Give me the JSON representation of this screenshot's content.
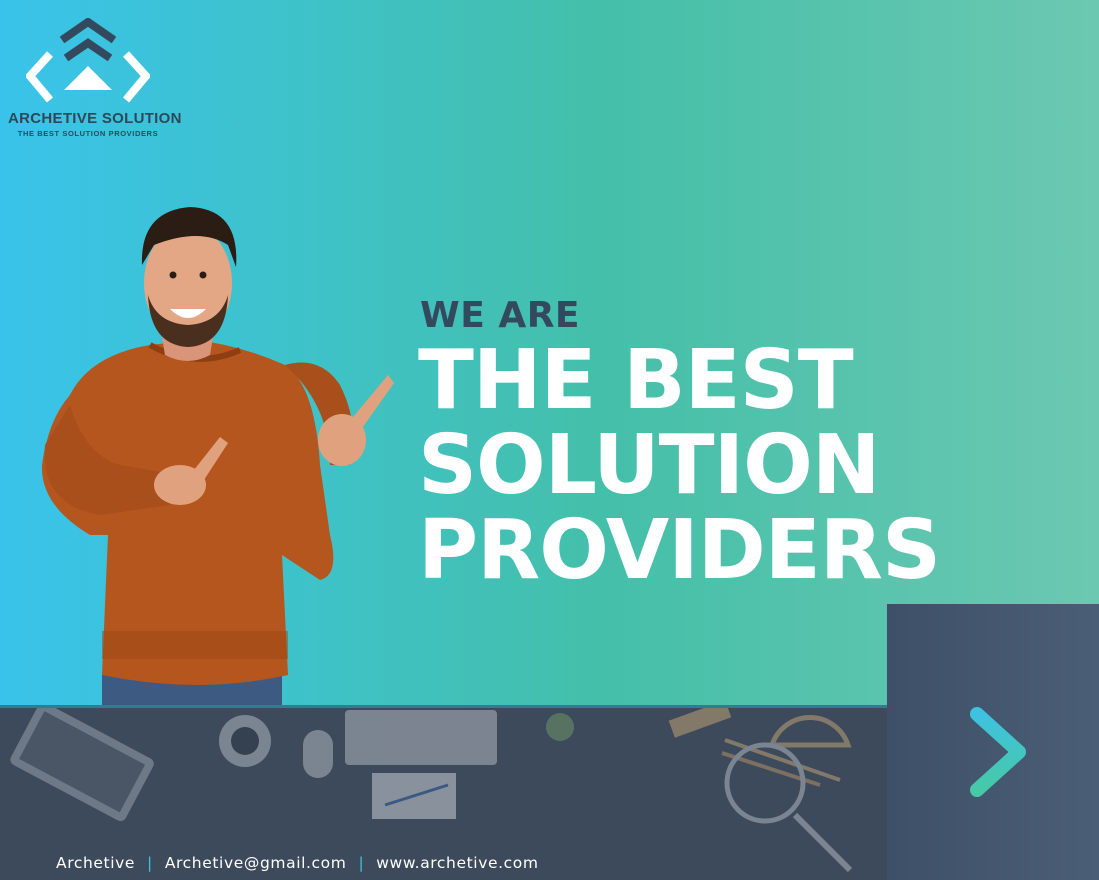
{
  "brand": {
    "name": "ARCHETIVE SOLUTION",
    "tagline": "THE BEST SOLUTION PROVIDERS"
  },
  "hero": {
    "kicker": "WE ARE",
    "line1": "THE BEST",
    "line2": "SOLUTION",
    "line3": "PROVIDERS"
  },
  "footer": {
    "company": "Archetive",
    "separator": "|",
    "email": "Archetive@gmail.com",
    "website": "www.archetive.com"
  },
  "icons": {
    "logo": "chevron-brackets-logo-icon",
    "next": "chevron-right-icon"
  },
  "colors": {
    "gradient_left": "#39c3ea",
    "gradient_right": "#6cc8b1",
    "dark_navy": "#34495e",
    "panel": "#3d5068",
    "accent": "#3fc2e0"
  }
}
